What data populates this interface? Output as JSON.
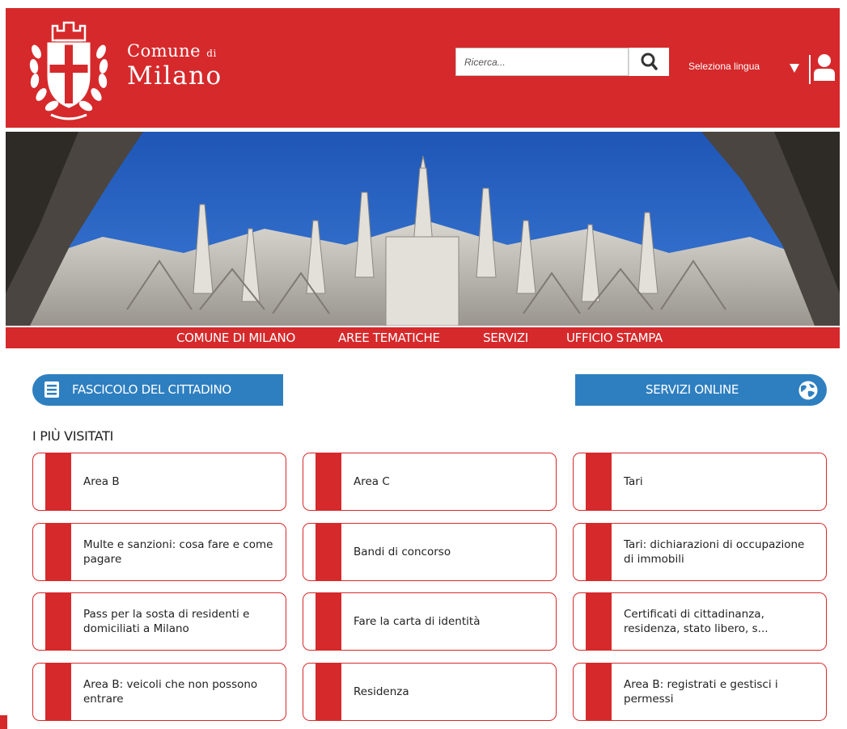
{
  "header": {
    "brand_line1": "Comune",
    "brand_line1_small": "di",
    "brand_line2": "Milano",
    "search_placeholder": "Ricerca...",
    "language_label": "Seleziona lingua"
  },
  "nav": {
    "items": [
      "COMUNE DI MILANO",
      "AREE TEMATICHE",
      "SERVIZI",
      "UFFICIO STAMPA"
    ]
  },
  "quick_links": {
    "fascicolo": "FASCICOLO DEL CITTADINO",
    "servizi_online": "SERVIZI ONLINE"
  },
  "most_visited": {
    "title": "I PIÙ VISITATI",
    "items": [
      "Area B",
      "Area C",
      "Tari",
      "Multe e sanzioni: cosa fare e come pagare",
      "Bandi di concorso",
      "Tari: dichiarazioni di occupazione di immobili",
      "Pass per la sosta di residenti e domiciliati a Milano",
      "Fare la carta di identità",
      "Certificati di cittadinanza, residenza, stato libero, s...",
      "Area B: veicoli che non possono entrare",
      "Residenza",
      "Area B: registrati e gestisci i permessi"
    ]
  },
  "colors": {
    "brand_red": "#d6292b",
    "accent_blue": "#2e7fc0"
  },
  "icons": [
    "coat-of-arms-logo",
    "search-icon",
    "dropdown-arrow-icon",
    "user-icon",
    "book-icon",
    "globe-icon"
  ]
}
